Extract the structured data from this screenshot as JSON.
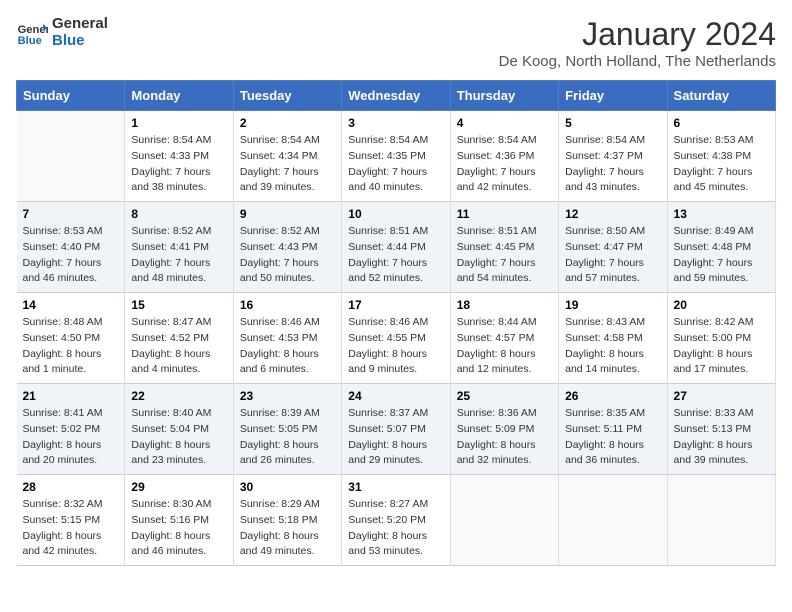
{
  "header": {
    "logo_line1": "General",
    "logo_line2": "Blue",
    "title": "January 2024",
    "subtitle": "De Koog, North Holland, The Netherlands"
  },
  "weekdays": [
    "Sunday",
    "Monday",
    "Tuesday",
    "Wednesday",
    "Thursday",
    "Friday",
    "Saturday"
  ],
  "weeks": [
    [
      {
        "day": "",
        "sunrise": "",
        "sunset": "",
        "daylight": ""
      },
      {
        "day": "1",
        "sunrise": "8:54 AM",
        "sunset": "4:33 PM",
        "daylight": "7 hours and 38 minutes."
      },
      {
        "day": "2",
        "sunrise": "8:54 AM",
        "sunset": "4:34 PM",
        "daylight": "7 hours and 39 minutes."
      },
      {
        "day": "3",
        "sunrise": "8:54 AM",
        "sunset": "4:35 PM",
        "daylight": "7 hours and 40 minutes."
      },
      {
        "day": "4",
        "sunrise": "8:54 AM",
        "sunset": "4:36 PM",
        "daylight": "7 hours and 42 minutes."
      },
      {
        "day": "5",
        "sunrise": "8:54 AM",
        "sunset": "4:37 PM",
        "daylight": "7 hours and 43 minutes."
      },
      {
        "day": "6",
        "sunrise": "8:53 AM",
        "sunset": "4:38 PM",
        "daylight": "7 hours and 45 minutes."
      }
    ],
    [
      {
        "day": "7",
        "sunrise": "8:53 AM",
        "sunset": "4:40 PM",
        "daylight": "7 hours and 46 minutes."
      },
      {
        "day": "8",
        "sunrise": "8:52 AM",
        "sunset": "4:41 PM",
        "daylight": "7 hours and 48 minutes."
      },
      {
        "day": "9",
        "sunrise": "8:52 AM",
        "sunset": "4:43 PM",
        "daylight": "7 hours and 50 minutes."
      },
      {
        "day": "10",
        "sunrise": "8:51 AM",
        "sunset": "4:44 PM",
        "daylight": "7 hours and 52 minutes."
      },
      {
        "day": "11",
        "sunrise": "8:51 AM",
        "sunset": "4:45 PM",
        "daylight": "7 hours and 54 minutes."
      },
      {
        "day": "12",
        "sunrise": "8:50 AM",
        "sunset": "4:47 PM",
        "daylight": "7 hours and 57 minutes."
      },
      {
        "day": "13",
        "sunrise": "8:49 AM",
        "sunset": "4:48 PM",
        "daylight": "7 hours and 59 minutes."
      }
    ],
    [
      {
        "day": "14",
        "sunrise": "8:48 AM",
        "sunset": "4:50 PM",
        "daylight": "8 hours and 1 minute."
      },
      {
        "day": "15",
        "sunrise": "8:47 AM",
        "sunset": "4:52 PM",
        "daylight": "8 hours and 4 minutes."
      },
      {
        "day": "16",
        "sunrise": "8:46 AM",
        "sunset": "4:53 PM",
        "daylight": "8 hours and 6 minutes."
      },
      {
        "day": "17",
        "sunrise": "8:46 AM",
        "sunset": "4:55 PM",
        "daylight": "8 hours and 9 minutes."
      },
      {
        "day": "18",
        "sunrise": "8:44 AM",
        "sunset": "4:57 PM",
        "daylight": "8 hours and 12 minutes."
      },
      {
        "day": "19",
        "sunrise": "8:43 AM",
        "sunset": "4:58 PM",
        "daylight": "8 hours and 14 minutes."
      },
      {
        "day": "20",
        "sunrise": "8:42 AM",
        "sunset": "5:00 PM",
        "daylight": "8 hours and 17 minutes."
      }
    ],
    [
      {
        "day": "21",
        "sunrise": "8:41 AM",
        "sunset": "5:02 PM",
        "daylight": "8 hours and 20 minutes."
      },
      {
        "day": "22",
        "sunrise": "8:40 AM",
        "sunset": "5:04 PM",
        "daylight": "8 hours and 23 minutes."
      },
      {
        "day": "23",
        "sunrise": "8:39 AM",
        "sunset": "5:05 PM",
        "daylight": "8 hours and 26 minutes."
      },
      {
        "day": "24",
        "sunrise": "8:37 AM",
        "sunset": "5:07 PM",
        "daylight": "8 hours and 29 minutes."
      },
      {
        "day": "25",
        "sunrise": "8:36 AM",
        "sunset": "5:09 PM",
        "daylight": "8 hours and 32 minutes."
      },
      {
        "day": "26",
        "sunrise": "8:35 AM",
        "sunset": "5:11 PM",
        "daylight": "8 hours and 36 minutes."
      },
      {
        "day": "27",
        "sunrise": "8:33 AM",
        "sunset": "5:13 PM",
        "daylight": "8 hours and 39 minutes."
      }
    ],
    [
      {
        "day": "28",
        "sunrise": "8:32 AM",
        "sunset": "5:15 PM",
        "daylight": "8 hours and 42 minutes."
      },
      {
        "day": "29",
        "sunrise": "8:30 AM",
        "sunset": "5:16 PM",
        "daylight": "8 hours and 46 minutes."
      },
      {
        "day": "30",
        "sunrise": "8:29 AM",
        "sunset": "5:18 PM",
        "daylight": "8 hours and 49 minutes."
      },
      {
        "day": "31",
        "sunrise": "8:27 AM",
        "sunset": "5:20 PM",
        "daylight": "8 hours and 53 minutes."
      },
      {
        "day": "",
        "sunrise": "",
        "sunset": "",
        "daylight": ""
      },
      {
        "day": "",
        "sunrise": "",
        "sunset": "",
        "daylight": ""
      },
      {
        "day": "",
        "sunrise": "",
        "sunset": "",
        "daylight": ""
      }
    ]
  ],
  "labels": {
    "sunrise": "Sunrise:",
    "sunset": "Sunset:",
    "daylight": "Daylight:"
  }
}
